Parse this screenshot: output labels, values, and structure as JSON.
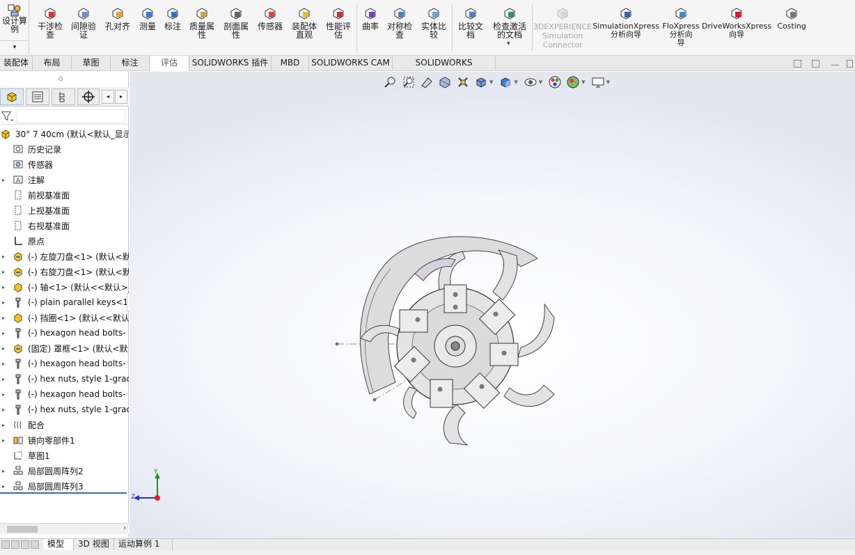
{
  "ribbon": {
    "design_study": "设计算\n例",
    "buttons": [
      {
        "id": "interference",
        "label": "干涉检\n查",
        "icon": "interference-check-icon"
      },
      {
        "id": "clearance",
        "label": "间隙验\n证",
        "icon": "clearance-verification-icon"
      },
      {
        "id": "hole-align",
        "label": "孔对齐",
        "icon": "hole-alignment-icon"
      },
      {
        "id": "measure",
        "label": "测量",
        "icon": "measure-icon"
      },
      {
        "id": "markup",
        "label": "标注",
        "icon": "markup-icon"
      },
      {
        "id": "mass-props",
        "label": "质量属\n性",
        "icon": "mass-properties-icon"
      },
      {
        "id": "section-props",
        "label": "剖面属\n性",
        "icon": "section-properties-icon"
      },
      {
        "id": "sensor",
        "label": "传感器",
        "icon": "sensor-icon"
      },
      {
        "id": "asm-viz",
        "label": "装配体\n直观",
        "icon": "assembly-visualization-icon"
      },
      {
        "id": "perf-eval",
        "label": "性能评\n估",
        "icon": "performance-evaluation-icon"
      },
      {
        "id": "curvature",
        "label": "曲率",
        "icon": "curvature-icon"
      },
      {
        "id": "symmetry",
        "label": "对称检\n查",
        "icon": "symmetry-check-icon"
      },
      {
        "id": "compare-body",
        "label": "实体比\n较",
        "icon": "compare-bodies-icon"
      },
      {
        "id": "compare-doc",
        "label": "比较文\n档",
        "icon": "compare-documents-icon"
      },
      {
        "id": "check-doc",
        "label": "检查激活\n的文档",
        "icon": "check-active-document-icon"
      },
      {
        "id": "3dx",
        "label": "3DEXPERIENCE\nSimulation\nConnector",
        "icon": "3dexperience-icon"
      },
      {
        "id": "simxpress",
        "label": "SimulationXpress\n分析向导",
        "icon": "simulationxpress-icon"
      },
      {
        "id": "floxpress",
        "label": "FloXpress\n分析向\n导",
        "icon": "floxpress-icon"
      },
      {
        "id": "driveworks",
        "label": "DriveWorksXpress\n向导",
        "icon": "driveworksxpress-icon"
      },
      {
        "id": "costing",
        "label": "Costing",
        "icon": "costing-icon"
      }
    ]
  },
  "tabs": [
    "装配体",
    "布局",
    "草图",
    "标注",
    "评估",
    "SOLIDWORKS 插件",
    "MBD",
    "SOLIDWORKS CAM",
    "SOLIDWORKS Inspection"
  ],
  "tree": {
    "root": "30° 7 40cm  (默认<默认_显示",
    "items": [
      {
        "label": "历史记录",
        "icon": "history-icon",
        "arrow": false
      },
      {
        "label": "传感器",
        "icon": "sensor-folder-icon",
        "arrow": false
      },
      {
        "label": "注解",
        "icon": "annotations-icon",
        "arrow": true
      },
      {
        "label": "前视基准面",
        "icon": "plane-icon",
        "arrow": false
      },
      {
        "label": "上视基准面",
        "icon": "plane-icon",
        "arrow": false
      },
      {
        "label": "右视基准面",
        "icon": "plane-icon",
        "arrow": false
      },
      {
        "label": "原点",
        "icon": "origin-icon",
        "arrow": false
      },
      {
        "label": "(-) 左旋刀盘<1> (默认<默",
        "icon": "subassembly-icon",
        "arrow": true
      },
      {
        "label": "(-) 右旋刀盘<1> (默认<默",
        "icon": "subassembly-icon",
        "arrow": true
      },
      {
        "label": "(-) 轴<1> (默认<<默认>_",
        "icon": "part-icon",
        "arrow": true
      },
      {
        "label": "(-) plain parallel keys<1",
        "icon": "toolbox-part-icon",
        "arrow": true
      },
      {
        "label": "(-) 挡圈<1> (默认<<默认",
        "icon": "part-icon",
        "arrow": true
      },
      {
        "label": "(-) hexagon head bolts-",
        "icon": "toolbox-part-icon",
        "arrow": true
      },
      {
        "label": "(固定) 罩框<1> (默认<默",
        "icon": "subassembly-icon",
        "arrow": true
      },
      {
        "label": "(-) hexagon head bolts-",
        "icon": "toolbox-part-icon",
        "arrow": true
      },
      {
        "label": "(-) hex nuts, style 1-grad",
        "icon": "toolbox-part-icon",
        "arrow": true
      },
      {
        "label": "(-) hexagon head bolts-",
        "icon": "toolbox-part-icon",
        "arrow": true
      },
      {
        "label": "(-) hex nuts, style 1-grad",
        "icon": "toolbox-part-icon",
        "arrow": true
      },
      {
        "label": "配合",
        "icon": "mates-icon",
        "arrow": true
      },
      {
        "label": "镜向零部件1",
        "icon": "mirror-components-icon",
        "arrow": true
      },
      {
        "label": "草图1",
        "icon": "sketch-icon",
        "arrow": false
      },
      {
        "label": "局部圆周阵列2",
        "icon": "circular-pattern-icon",
        "arrow": true
      },
      {
        "label": "局部圆周阵列3",
        "icon": "circular-pattern-icon",
        "arrow": true
      }
    ]
  },
  "triad": {
    "y": "Y",
    "z": "Z"
  },
  "bottom_tabs": [
    "模型",
    "3D 视图",
    "运动算例 1"
  ],
  "colors": {
    "accent": "#2a6fd0",
    "ribbon_bg": "#f5f5f5",
    "tree_selection": "#2a6fd0"
  }
}
